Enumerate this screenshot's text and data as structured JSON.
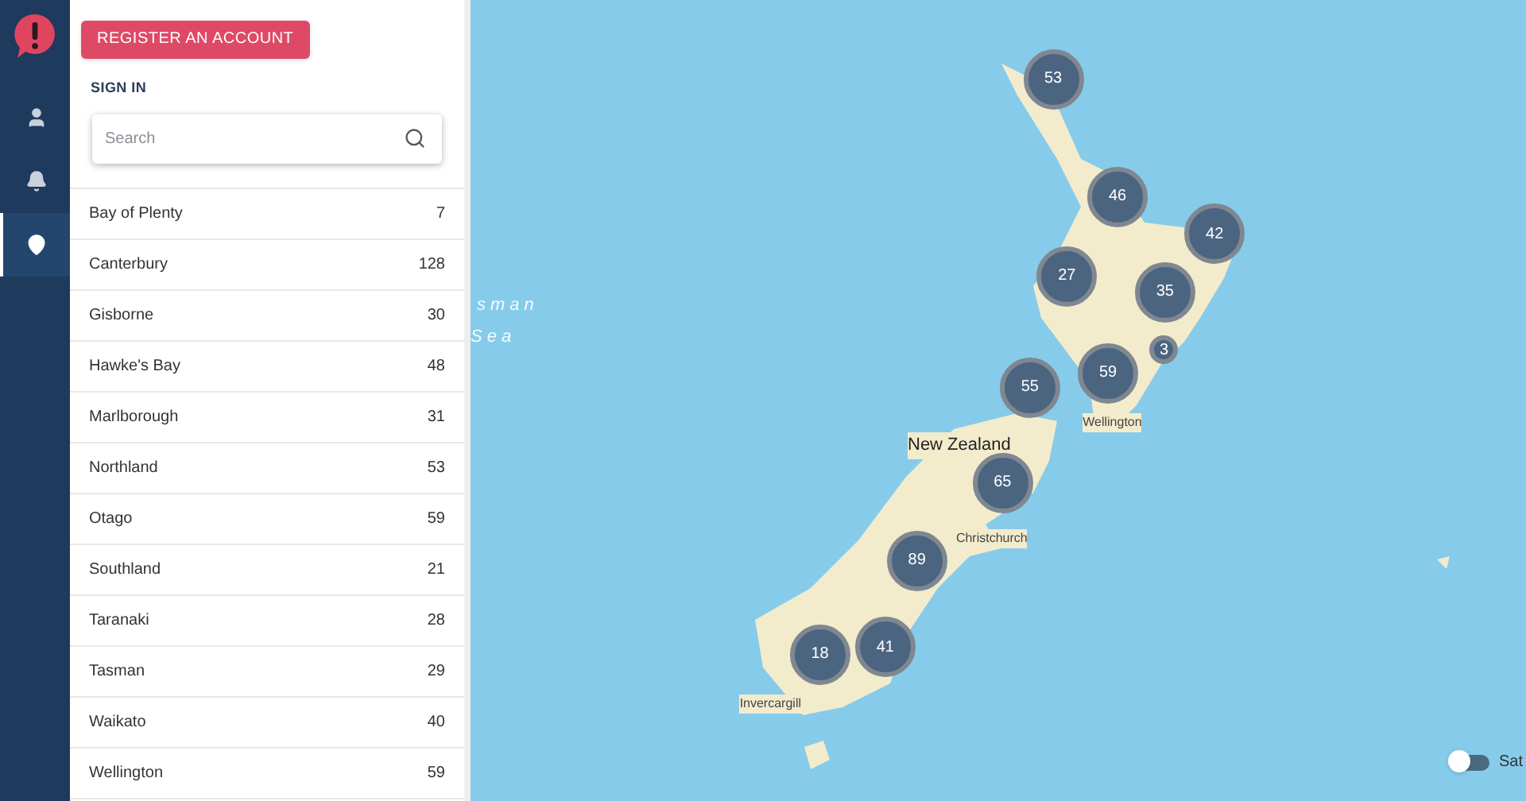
{
  "nav": {
    "items": [
      {
        "selected": false
      },
      {
        "selected": false
      },
      {
        "selected": true
      }
    ]
  },
  "panel": {
    "register_button": "REGISTER AN ACCOUNT",
    "sign_in": "SIGN IN",
    "search": {
      "placeholder": "Search"
    },
    "regions": [
      {
        "name": "Bay of Plenty",
        "count": "7"
      },
      {
        "name": "Canterbury",
        "count": "128"
      },
      {
        "name": "Gisborne",
        "count": "30"
      },
      {
        "name": "Hawke's Bay",
        "count": "48"
      },
      {
        "name": "Marlborough",
        "count": "31"
      },
      {
        "name": "Northland",
        "count": "53"
      },
      {
        "name": "Otago",
        "count": "59"
      },
      {
        "name": "Southland",
        "count": "21"
      },
      {
        "name": "Taranaki",
        "count": "28"
      },
      {
        "name": "Tasman",
        "count": "29"
      },
      {
        "name": "Waikato",
        "count": "40"
      },
      {
        "name": "Wellington",
        "count": "59"
      }
    ]
  },
  "map": {
    "sea_labels": [
      "sman",
      "Sea"
    ],
    "country_label": "New Zealand",
    "place_labels": [
      "Wellington",
      "Christchurch",
      "Invercargill"
    ],
    "clusters": [
      "53",
      "46",
      "42",
      "27",
      "35",
      "3",
      "59",
      "55",
      "65",
      "89",
      "18",
      "41"
    ],
    "satellite_toggle": {
      "label": "Sat",
      "on": false
    }
  }
}
